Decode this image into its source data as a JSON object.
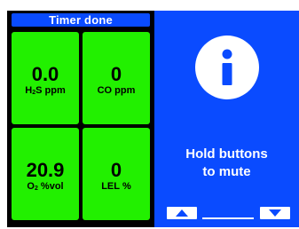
{
  "status_bar": {
    "text": "Timer done"
  },
  "gas_readings": [
    {
      "value": "0.0",
      "gas": "H",
      "gas_sub": "2",
      "gas_rest": "S",
      "unit": " ppm",
      "color": "#22f000"
    },
    {
      "value": "0",
      "gas": "CO",
      "gas_sub": "",
      "gas_rest": "",
      "unit": " ppm",
      "color": "#22f000"
    },
    {
      "value": "20.9",
      "gas": "O",
      "gas_sub": "2",
      "gas_rest": "",
      "unit": " %vol",
      "color": "#22f000"
    },
    {
      "value": "0",
      "gas": "LEL",
      "gas_sub": "",
      "gas_rest": "",
      "unit": " %",
      "color": "#22f000"
    }
  ],
  "info_panel": {
    "icon": "info-icon",
    "message_line1": "Hold buttons",
    "message_line2": "to mute",
    "color": "#0a4bff"
  },
  "buttons": {
    "up_icon": "triangle-up-icon",
    "down_icon": "triangle-down-icon"
  }
}
